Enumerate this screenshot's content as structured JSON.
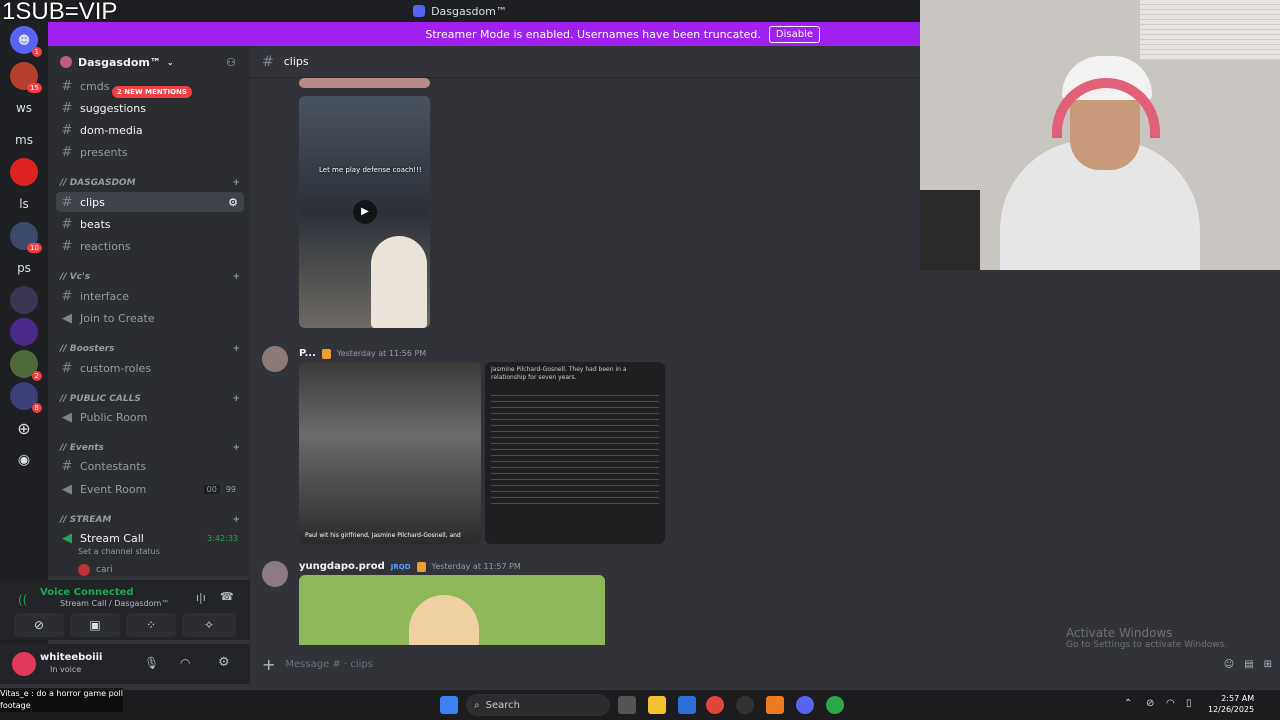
{
  "overlay_text": "1SUB=VIP",
  "window_title": "Dasgasdom™",
  "streamer_banner": {
    "text": "Streamer Mode is enabled. Usernames have been truncated.",
    "button": "Disable"
  },
  "servers": [
    {
      "label": "",
      "badge": "1"
    },
    {
      "label": "",
      "badge": "15"
    },
    {
      "label": "ws",
      "badge": ""
    },
    {
      "label": "ms",
      "badge": ""
    },
    {
      "label": "",
      "badge": ""
    },
    {
      "label": "ls",
      "badge": ""
    },
    {
      "label": "",
      "badge": "10"
    },
    {
      "label": "ps",
      "badge": ""
    },
    {
      "label": "",
      "badge": ""
    },
    {
      "label": "",
      "badge": ""
    },
    {
      "label": "",
      "badge": "2"
    },
    {
      "label": "",
      "badge": "8"
    }
  ],
  "guild": {
    "name": "Dasgasdom™"
  },
  "mentions_pill": "2 NEW MENTIONS",
  "channels": {
    "cmds": "cmds",
    "suggestions": "suggestions",
    "dom_media": "dom-media",
    "presents": "presents",
    "cat_dasgasdom": "// DASGASDOM",
    "clips": "clips",
    "beats": "beats",
    "reactions": "reactions",
    "cat_vcs": "// Vc's",
    "interface": "interface",
    "join_create": "Join to Create",
    "cat_boosters": "// Boosters",
    "custom_roles": "custom-roles",
    "cat_public": "// PUBLIC CALLS",
    "public_room": "Public Room",
    "cat_events": "// Events",
    "contestants": "Contestants",
    "event_room": "Event Room",
    "event_room_count": "00",
    "event_room_limit": "99",
    "cat_stream": "// STREAM",
    "stream_call": "Stream Call",
    "stream_timer": "3:42:33",
    "set_status": "Set a channel status",
    "member_cari": "cari"
  },
  "voice": {
    "status": "Voice Connected",
    "channel": "Stream Call / Dasgasdom™"
  },
  "user": {
    "name": "whiteeboiii",
    "status": "In voice"
  },
  "chat_header": "clips",
  "messages": [
    {
      "author": "P...",
      "time": "Yesterday at 11:56 PM",
      "caption": "Paul wit his girlfriend, Jasmine Pilchard-Gosnell, and",
      "article_title": "Jasmine Pilchard-Gosnell. They had been in a relationship for seven years."
    },
    {
      "author": "yungdapo.prod",
      "tag": "JRQD",
      "time": "Yesterday at 11:57 PM"
    }
  ],
  "video_text": "Let me play defense coach!!!",
  "composer_placeholder": "Message # · clips",
  "activate": {
    "title": "Activate Windows",
    "sub": "Go to Settings to activate Windows."
  },
  "taskbar": {
    "search": "Search",
    "time": "2:57 AM",
    "date": "12/26/2025"
  },
  "bottom_left": [
    "Vitas_e : do a horror game poll",
    "footage"
  ],
  "colors": {
    "banner": "#a020f0",
    "accent_green": "#23a55a",
    "background": "#313338",
    "sidebar": "#2b2d31"
  }
}
